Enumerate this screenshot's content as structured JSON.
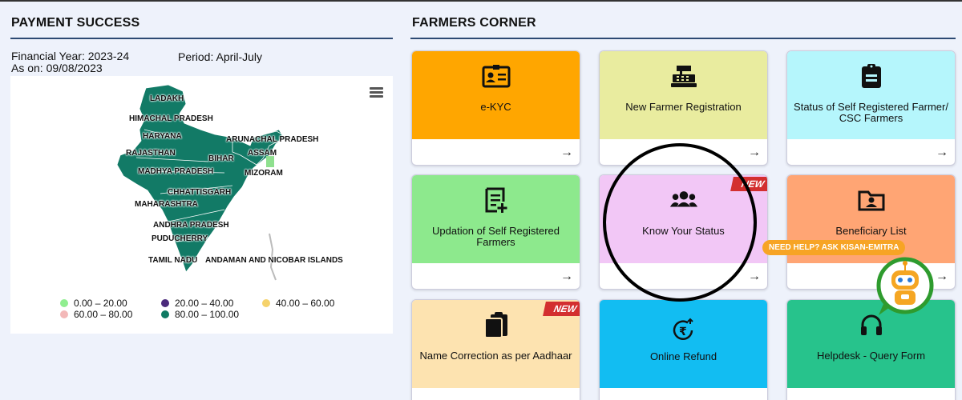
{
  "payment": {
    "title": "PAYMENT SUCCESS",
    "fy_line": "Financial Year: 2023-24",
    "as_on_line": "As on: 09/08/2023",
    "period": "Period: April-July",
    "menu_icon": "hamburger-icon",
    "map_labels": {
      "ladakh": "LADAKH",
      "himachal": "HIMACHAL PRADESH",
      "haryana": "HARYANA",
      "arunachal": "ARUNACHAL PRADESH",
      "rajasthan": "RAJASTHAN",
      "bihar": "BIHAR",
      "assam": "ASSAM",
      "madhya": "MADHYA PRADESH",
      "mizoram": "MIZORAM",
      "chhattisgarh": "CHHATTISGARH",
      "maharashtra": "MAHARASHTRA",
      "andhra": "ANDHRA PRADESH",
      "puducherry": "PUDUCHERRY",
      "tamil": "TAMIL NADU",
      "andaman": "ANDAMAN AND NICOBAR ISLANDS"
    },
    "legend": [
      {
        "label": "0.00 – 20.00",
        "color": "#90ee90"
      },
      {
        "label": "20.00 – 40.00",
        "color": "#4b2a7b"
      },
      {
        "label": "40.00 – 60.00",
        "color": "#f5d26b"
      },
      {
        "label": "60.00 – 80.00",
        "color": "#f3b8b8"
      },
      {
        "label": "80.00 – 100.00",
        "color": "#0f7a63"
      }
    ]
  },
  "farmers": {
    "title": "FARMERS CORNER",
    "cards": [
      {
        "label": "e-KYC",
        "color": "#ffa600",
        "icon": "id-card-icon",
        "new": false
      },
      {
        "label": "New Farmer Registration",
        "color": "#e9ec9f",
        "icon": "cash-register-icon",
        "new": false
      },
      {
        "label": "Status of Self Registered Farmer/ CSC Farmers",
        "color": "#b5f6fc",
        "icon": "clipboard-list-icon",
        "new": false
      },
      {
        "label": "Updation of Self Registered Farmers",
        "color": "#8de98d",
        "icon": "edit-document-icon",
        "new": false
      },
      {
        "label": "Know Your Status",
        "color": "#f2c7f6",
        "icon": "users-icon",
        "new": true
      },
      {
        "label": "Beneficiary List",
        "color": "#ffa574",
        "icon": "folder-contact-icon",
        "new": false
      },
      {
        "label": "Name Correction as per Aadhaar",
        "color": "#fde3b0",
        "icon": "clipboard-icon",
        "new": true
      },
      {
        "label": "Online Refund",
        "color": "#12bdf2",
        "icon": "rupee-refund-icon",
        "new": false
      },
      {
        "label": "Helpdesk - Query Form",
        "color": "#27c38c",
        "icon": "headset-icon",
        "new": false
      }
    ],
    "arrow": "→",
    "new_badge": "NEW",
    "help_text": "NEED HELP? ASK KISAN-EMITRA"
  }
}
